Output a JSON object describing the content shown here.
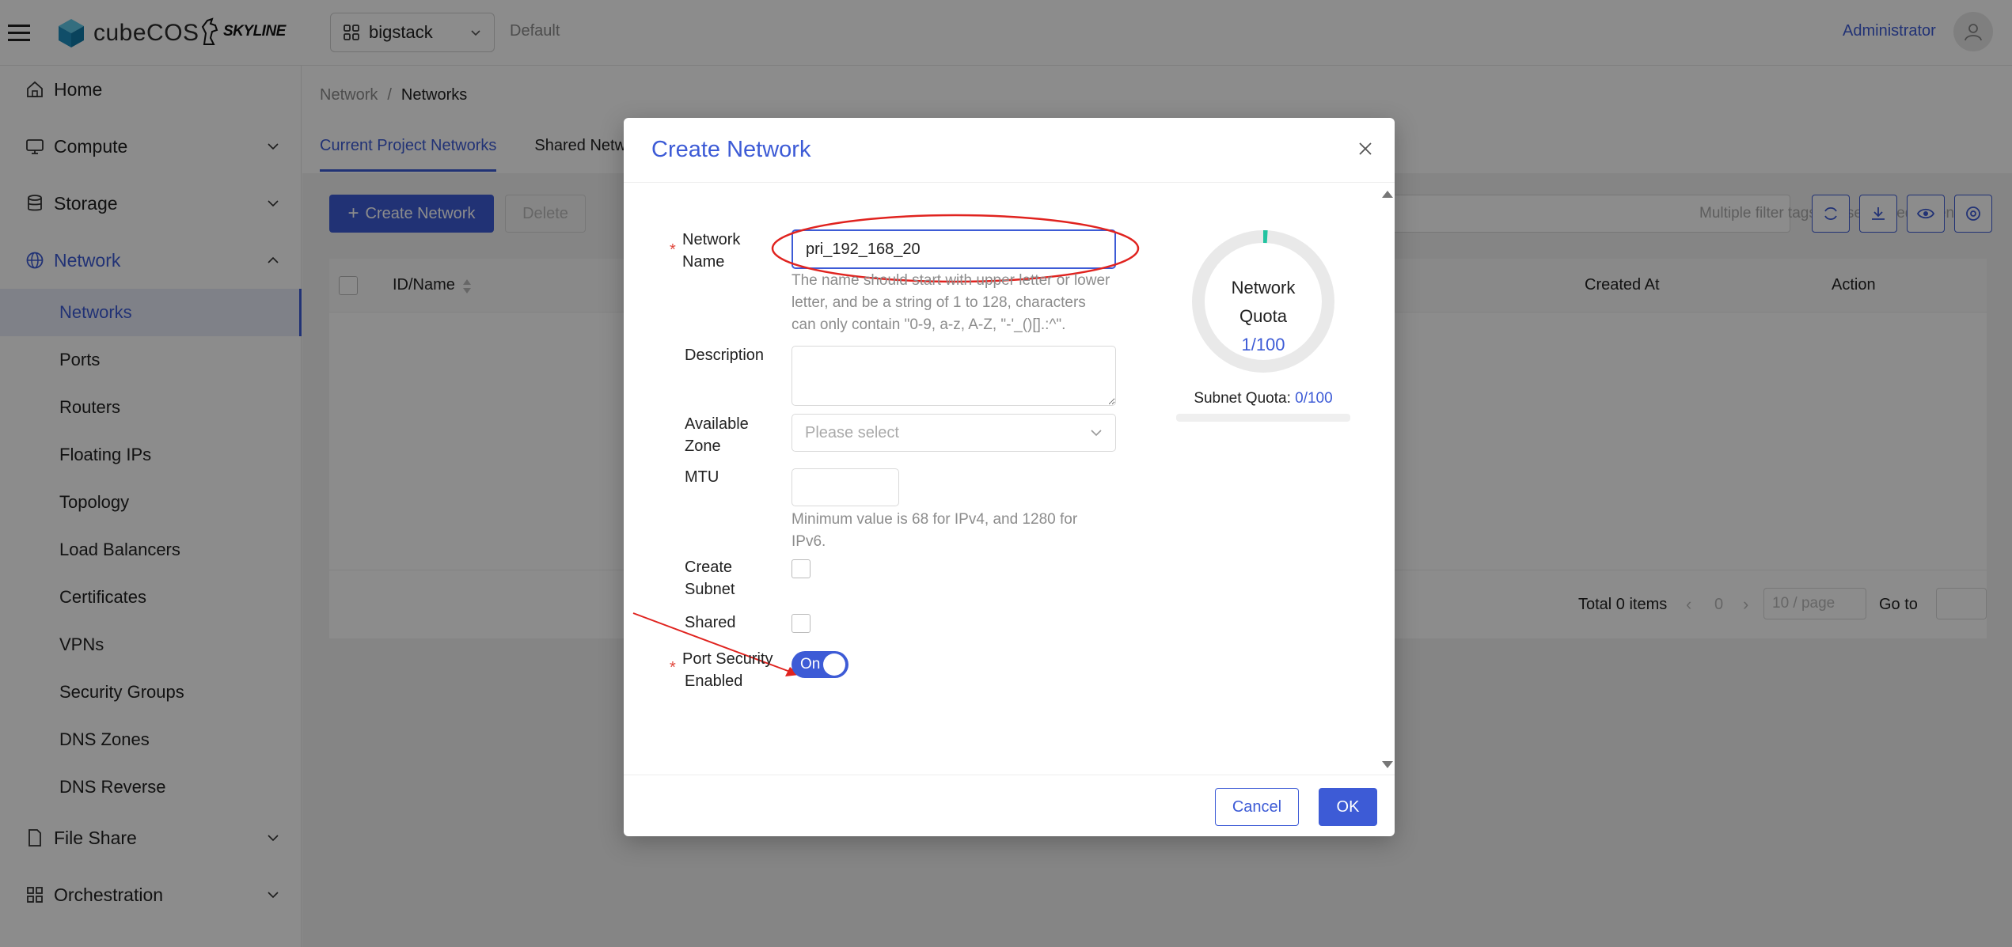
{
  "header": {
    "logo_text": "cubeCOS",
    "partner_logo": "SKYLINE",
    "project": "bigstack",
    "domain": "Default",
    "user": "Administrator"
  },
  "sidebar": {
    "items": [
      {
        "label": "Home",
        "icon": "home-icon"
      },
      {
        "label": "Compute",
        "icon": "monitor-icon"
      },
      {
        "label": "Storage",
        "icon": "database-icon"
      },
      {
        "label": "Network",
        "icon": "globe-icon"
      },
      {
        "label": "File Share",
        "icon": "file-icon"
      },
      {
        "label": "Orchestration",
        "icon": "cluster-icon"
      }
    ],
    "network_sub": [
      "Networks",
      "Ports",
      "Routers",
      "Floating IPs",
      "Topology",
      "Load Balancers",
      "Certificates",
      "VPNs",
      "Security Groups",
      "DNS Zones",
      "DNS Reverse"
    ]
  },
  "main": {
    "breadcrumb": [
      "Network",
      "Networks"
    ],
    "breadcrumb_sep": "/",
    "tabs": [
      "Current Project Networks",
      "Shared Networks"
    ],
    "create_label": "Create Network",
    "delete_label": "Delete",
    "search_placeholder": "Multiple filter tags are separated by enter",
    "columns": [
      "ID/Name",
      "Created At",
      "Action"
    ],
    "pagination": {
      "total": "Total 0 items",
      "page": "0",
      "page_size": "10 / page",
      "goto": "Go to"
    }
  },
  "modal": {
    "title": "Create Network",
    "fields": {
      "network_name": {
        "label1": "Network",
        "label2": "Name",
        "value": "pri_192_168_20"
      },
      "name_hint": [
        "The name should start with upper letter or lower",
        "letter, and be a string of 1 to 128, characters",
        "can only contain \"0-9, a-z, A-Z, \"-'_()[].:^\"."
      ],
      "description": {
        "label": "Description",
        "value": ""
      },
      "available_zone": {
        "label1": "Available",
        "label2": "Zone",
        "placeholder": "Please select"
      },
      "mtu": {
        "label": "MTU",
        "value": ""
      },
      "mtu_hint": [
        "Minimum value is 68 for IPv4, and 1280 for",
        "IPv6."
      ],
      "create_subnet": {
        "label1": "Create",
        "label2": "Subnet"
      },
      "shared": {
        "label": "Shared"
      },
      "port_security": {
        "label1": "Port Security",
        "label2": "Enabled",
        "state": "On"
      }
    },
    "quota": {
      "title1": "Network",
      "title2": "Quota",
      "used": 1,
      "total": 100,
      "value_text": "1/100",
      "subnet_label": "Subnet Quota:",
      "subnet_value": "0/100"
    },
    "cancel_label": "Cancel",
    "ok_label": "OK"
  },
  "colors": {
    "accent": "#3d5bd6",
    "annotation": "#e0231f",
    "quota_used": "#22c3a0"
  }
}
